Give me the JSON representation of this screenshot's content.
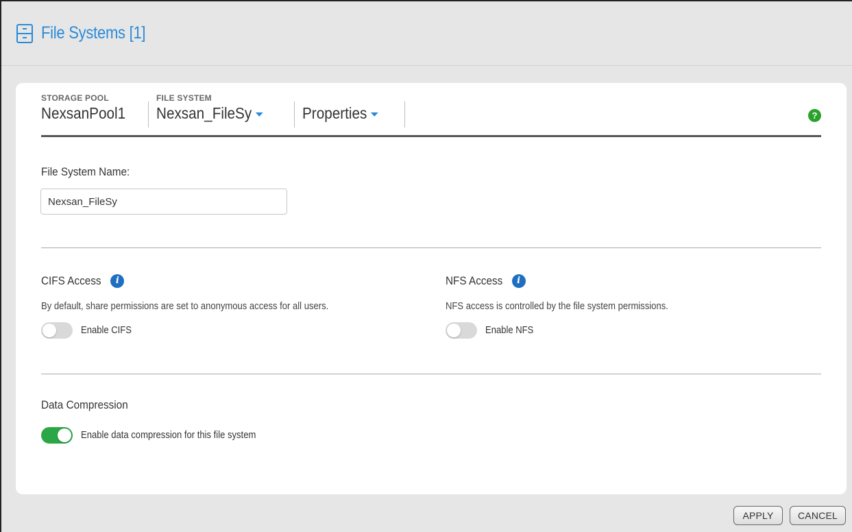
{
  "header": {
    "title": "File Systems [1]"
  },
  "breadcrumb": {
    "pool_label": "STORAGE POOL",
    "pool_value": "NexsanPool1",
    "fs_label": "FILE SYSTEM",
    "fs_value": "Nexsan_FileSy",
    "view_value": "Properties"
  },
  "help_icon": "?",
  "form": {
    "name_label": "File System Name:",
    "name_value": "Nexsan_FileSy"
  },
  "cifs": {
    "title": "CIFS Access",
    "description": "By default, share permissions are set to anonymous access for all users.",
    "toggle_label": "Enable CIFS",
    "enabled": false
  },
  "nfs": {
    "title": "NFS Access",
    "description": "NFS access is controlled by the file system permissions.",
    "toggle_label": "Enable NFS",
    "enabled": false
  },
  "compression": {
    "title": "Data Compression",
    "toggle_label": "Enable data compression for this file system",
    "enabled": true
  },
  "buttons": {
    "apply": "APPLY",
    "cancel": "CANCEL"
  },
  "colors": {
    "accent": "#2a8ad8",
    "toggle_on": "#2aa646",
    "help": "#2aa12a",
    "info": "#1f6fc1"
  },
  "icons": {
    "header": "file-cabinet-icon",
    "info": "info-icon",
    "help": "help-icon",
    "caret": "caret-down-icon"
  }
}
